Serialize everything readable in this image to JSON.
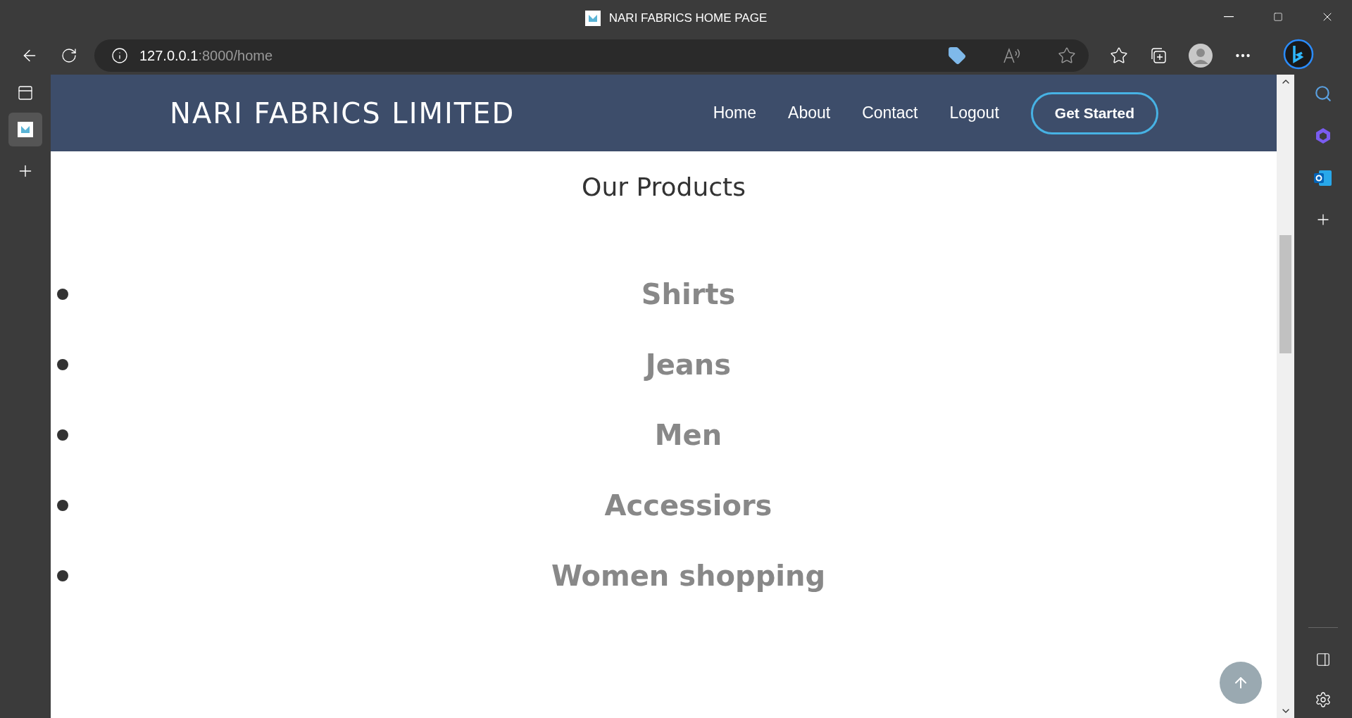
{
  "window": {
    "title": "NARI FABRICS HOME PAGE"
  },
  "address_bar": {
    "host": "127.0.0.1",
    "path": ":8000/home"
  },
  "site": {
    "brand": "NARI FABRICS LIMITED",
    "nav": [
      {
        "label": "Home",
        "kind": "link"
      },
      {
        "label": "About",
        "kind": "link"
      },
      {
        "label": "Contact",
        "kind": "link"
      },
      {
        "label": "Logout",
        "kind": "link"
      },
      {
        "label": "Get Started",
        "kind": "button"
      }
    ]
  },
  "products": {
    "heading": "Our Products",
    "items": [
      "Shirts",
      "Jeans",
      "Men",
      "Accessiors",
      "Women shopping"
    ]
  }
}
